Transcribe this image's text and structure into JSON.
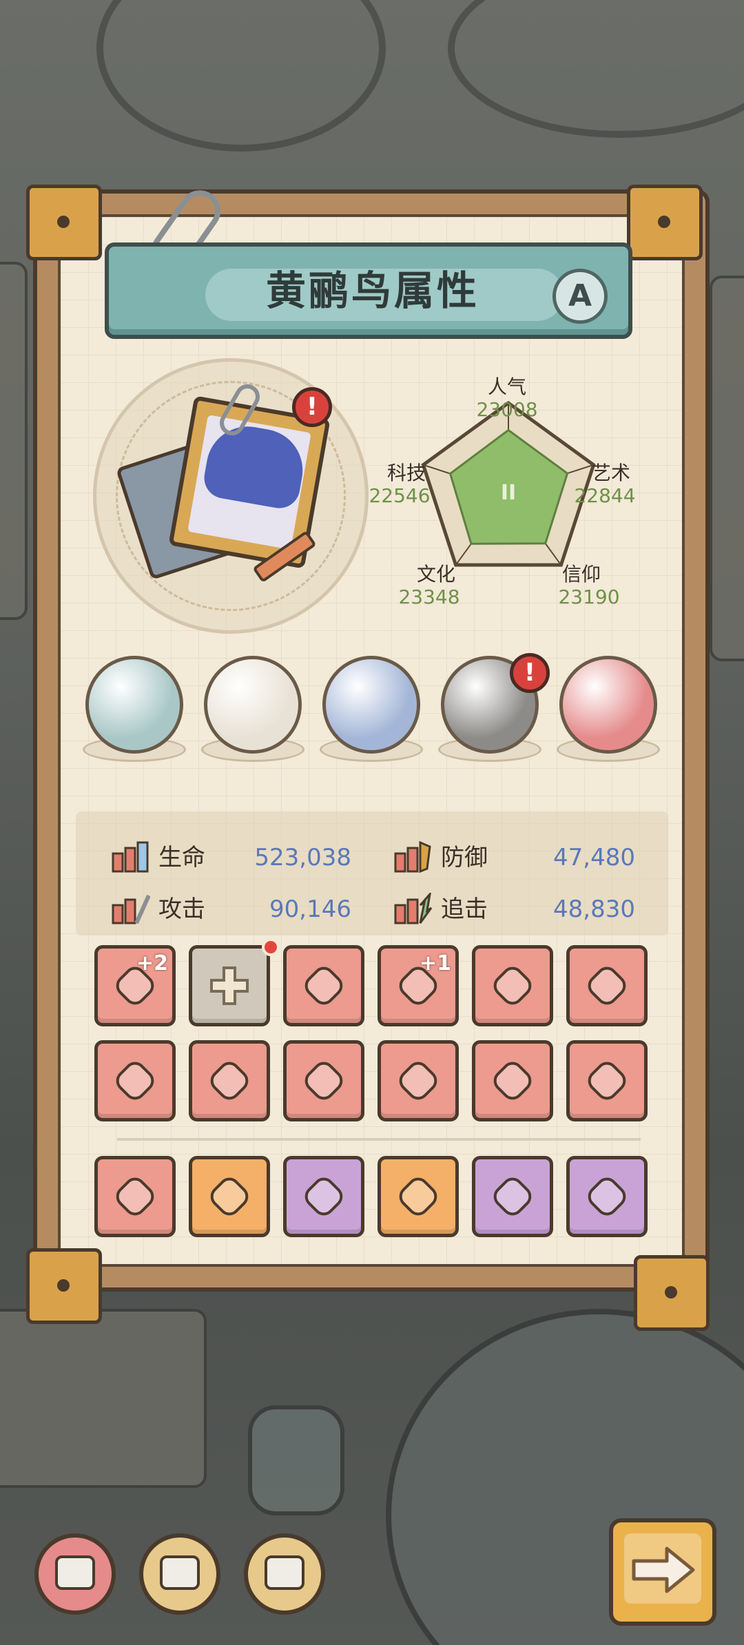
{
  "window": {
    "title": "黄鹂鸟属性",
    "grade": "A"
  },
  "radar": {
    "stats": [
      {
        "name": "人气",
        "value": "23008"
      },
      {
        "name": "艺术",
        "value": "22844"
      },
      {
        "name": "信仰",
        "value": "23190"
      },
      {
        "name": "文化",
        "value": "23348"
      },
      {
        "name": "科技",
        "value": "22546"
      }
    ],
    "center_mark": "II"
  },
  "chart_data": {
    "type": "radar",
    "categories": [
      "人气",
      "艺术",
      "信仰",
      "文化",
      "科技"
    ],
    "values": [
      23008,
      22844,
      23190,
      23348,
      22546
    ]
  },
  "attributes": {
    "hp": {
      "label": "生命",
      "value": "523,038"
    },
    "def": {
      "label": "防御",
      "value": "47,480"
    },
    "atk": {
      "label": "攻击",
      "value": "90,146"
    },
    "chase": {
      "label": "追击",
      "value": "48,830"
    }
  },
  "orbs": [
    {
      "icon": "turtle-orb-icon",
      "color": "#a9c7c7"
    },
    {
      "icon": "shell-orb-icon",
      "color": "#e8e2d6"
    },
    {
      "icon": "compass-orb-icon",
      "color": "#a4b6d8"
    },
    {
      "icon": "meteor-orb-icon",
      "color": "#8d8b88"
    },
    {
      "icon": "egg-orb-icon",
      "color": "#e58b8b"
    }
  ],
  "equipment_rows": [
    [
      {
        "icon": "ring-chain-icon",
        "color": "red",
        "plus": "+2"
      },
      {
        "icon": "add-slot-icon",
        "color": "gray",
        "plus": ""
      },
      {
        "icon": "necklace-icon",
        "color": "red",
        "plus": ""
      },
      {
        "icon": "serpent-staff-icon",
        "color": "red",
        "plus": "+1"
      },
      {
        "icon": "totem-mace-icon",
        "color": "red",
        "plus": ""
      },
      {
        "icon": "hammer-icon",
        "color": "red",
        "plus": ""
      }
    ],
    [
      {
        "icon": "leg-armor-icon",
        "color": "red",
        "plus": ""
      },
      {
        "icon": "broadsword-icon",
        "color": "red",
        "plus": ""
      },
      {
        "icon": "drill-sword-icon",
        "color": "red",
        "plus": ""
      },
      {
        "icon": "dagger-icon",
        "color": "red",
        "plus": ""
      },
      {
        "icon": "backpack-icon",
        "color": "red",
        "plus": ""
      },
      {
        "icon": "crystal-spear-icon",
        "color": "red",
        "plus": ""
      }
    ],
    [
      {
        "icon": "helmet-icon",
        "color": "red",
        "plus": ""
      },
      {
        "icon": "trident-icon",
        "color": "orange",
        "plus": ""
      },
      {
        "icon": "chest-armor-icon",
        "color": "purple",
        "plus": ""
      },
      {
        "icon": "magnify-staff-icon",
        "color": "orange",
        "plus": ""
      },
      {
        "icon": "scimitar-icon",
        "color": "purple",
        "plus": ""
      },
      {
        "icon": "gauntlet-icon",
        "color": "purple",
        "plus": ""
      }
    ]
  ],
  "bottom_tabs": [
    {
      "icon": "blue-crest-tab-icon",
      "color": "#e58b8b"
    },
    {
      "icon": "green-crest-tab-icon",
      "color": "#e7c98b"
    },
    {
      "icon": "pink-crest-tab-icon",
      "color": "#e7c98b"
    }
  ],
  "next_button_icon": "arrow-right-icon"
}
